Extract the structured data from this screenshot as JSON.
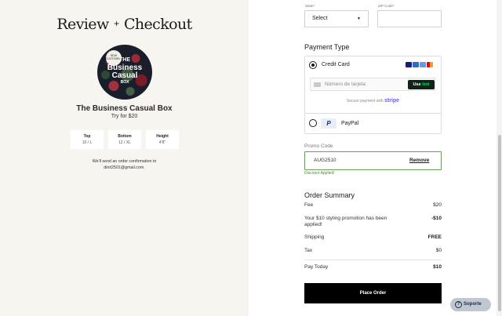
{
  "header": {
    "title_part1": "Review",
    "title_plus": "+",
    "title_part2": "Checkout"
  },
  "product": {
    "badge": "NEW CUSTOMER",
    "box_line1": "THE",
    "box_line2": "Business",
    "box_line3": "Casual",
    "box_line4": "BOX",
    "name": "The Business Casual Box",
    "subtitle": "Try for $20",
    "sizes": [
      {
        "label": "Top",
        "value": "10 / L"
      },
      {
        "label": "Bottom",
        "value": "12 / XL"
      },
      {
        "label": "Height",
        "value": "4'8\""
      }
    ],
    "confirmation_line1": "We'll send an order confirmation to",
    "confirmation_line2": "dinit2501@gmail.com."
  },
  "address": {
    "state_label": "State*",
    "state_value": "Select",
    "zip_label": "ZIP Code*",
    "zip_value": ""
  },
  "payment": {
    "heading": "Payment Type",
    "credit_card_label": "Credit Card",
    "card_placeholder": "Número de tarjeta",
    "link_user": "Use",
    "link_brand": "link",
    "secure_text": "Secure payment with",
    "secure_brand": "stripe",
    "paypal_label": "PayPal",
    "paypal_logo": "P",
    "selected": "credit_card",
    "card_brand_colors": [
      "#1a1f71",
      "#2a6ad3",
      "#5aa0e6",
      "#eb6b1f"
    ]
  },
  "promo": {
    "label": "Promo Code",
    "code": "AUG2510",
    "remove_label": "Remove",
    "status": "Discount Applied!"
  },
  "summary": {
    "heading": "Order Summary",
    "fee_label": "Fee",
    "fee_value": "$20",
    "promo_label": "Your $10 styling promotion has been applied!",
    "promo_value": "-$10",
    "shipping_label": "Shipping",
    "shipping_value": "FREE",
    "tax_label": "Tax",
    "tax_value": "$0",
    "total_label": "Pay Today",
    "total_value": "$10",
    "place_order_label": "Place Order"
  },
  "support": {
    "label": "Soporte",
    "icon": "?"
  }
}
